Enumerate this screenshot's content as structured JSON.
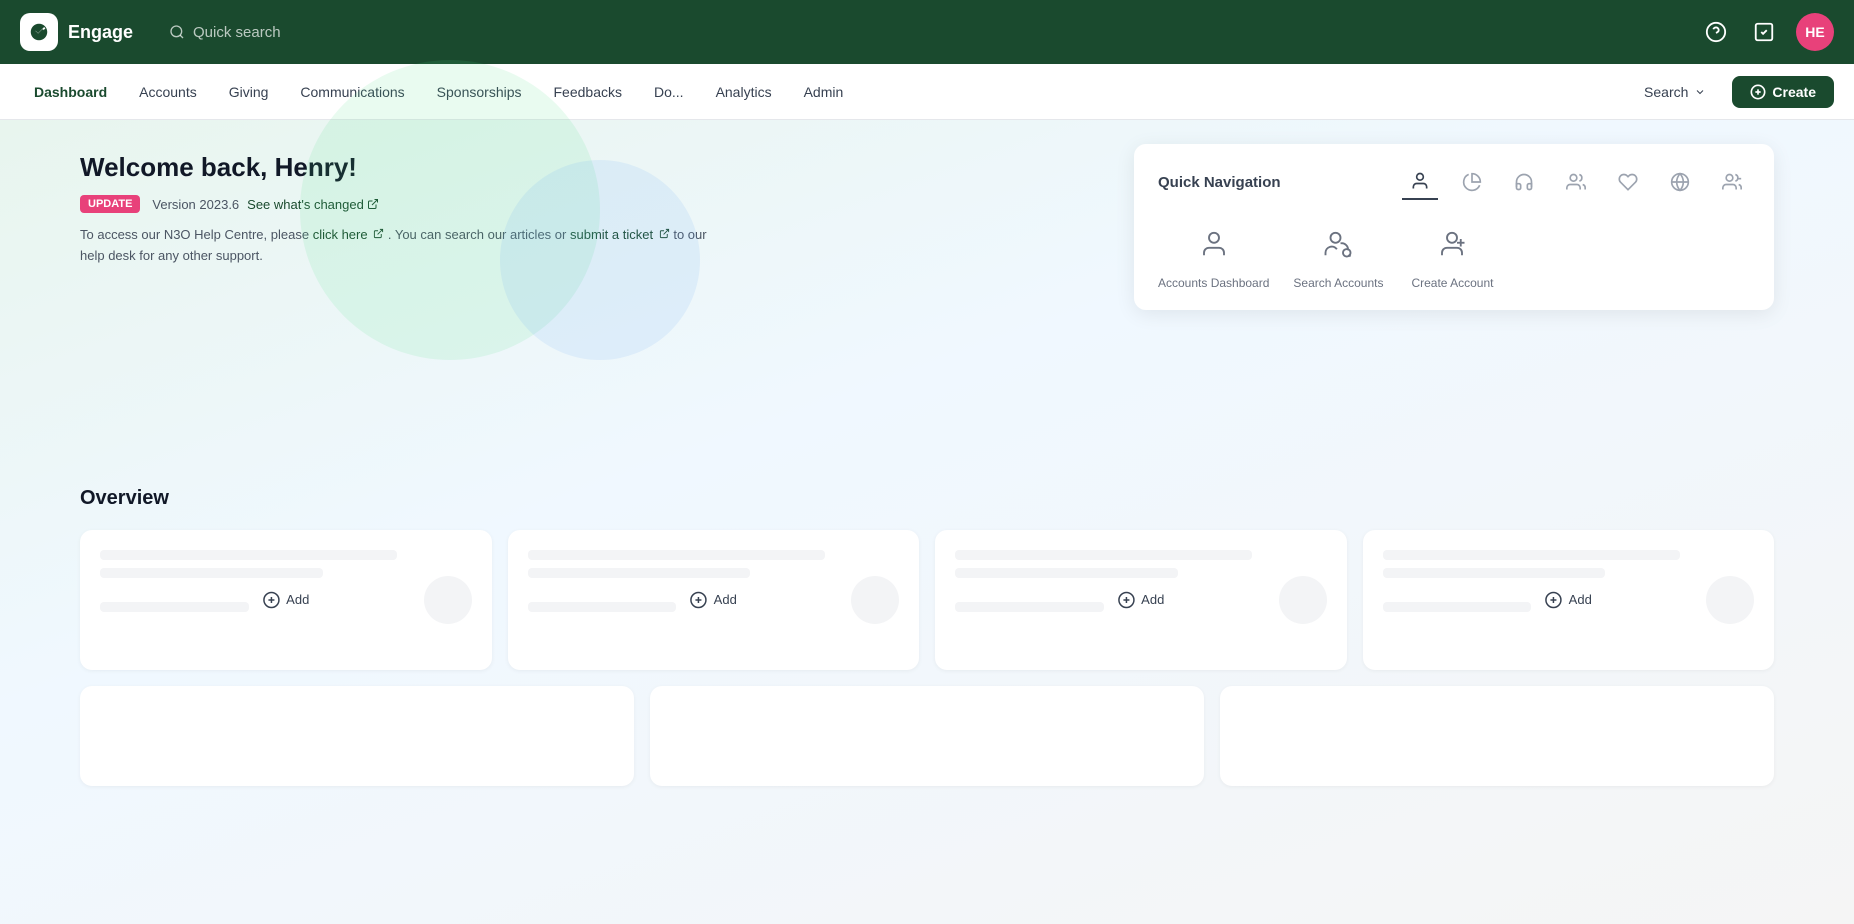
{
  "app": {
    "name": "Engage",
    "logo_alt": "engage-logo"
  },
  "topbar": {
    "quick_search_placeholder": "Quick search",
    "help_icon": "help-circle-icon",
    "task_icon": "task-icon",
    "avatar_initials": "HE",
    "avatar_color": "#e8417a"
  },
  "navbar": {
    "items": [
      {
        "label": "Dashboard",
        "active": true
      },
      {
        "label": "Accounts",
        "active": false
      },
      {
        "label": "Giving",
        "active": false
      },
      {
        "label": "Communications",
        "active": false
      },
      {
        "label": "Sponsorships",
        "active": false
      },
      {
        "label": "Feedbacks",
        "active": false
      },
      {
        "label": "Do...",
        "active": false
      },
      {
        "label": "Analytics",
        "active": false
      },
      {
        "label": "Admin",
        "active": false
      }
    ],
    "search_label": "Search",
    "create_label": "Create"
  },
  "welcome": {
    "title": "Welcome back, Henry!",
    "badge": "UPDATE",
    "version": "Version 2023.6",
    "see_changes": "See what's changed",
    "help_text_pre": "To access our N3O Help Centre, please",
    "click_here": "click here",
    "help_text_mid": ". You can search our articles or",
    "submit_ticket": "submit a ticket",
    "help_text_post": "to our help desk for any other support."
  },
  "quick_navigation": {
    "title": "Quick Navigation",
    "tabs": [
      {
        "name": "accounts",
        "icon": "person-icon",
        "active": true
      },
      {
        "name": "giving",
        "icon": "pie-chart-icon",
        "active": false
      },
      {
        "name": "communications",
        "icon": "headset-icon",
        "active": false
      },
      {
        "name": "sponsorships",
        "icon": "group-icon",
        "active": false
      },
      {
        "name": "favourites",
        "icon": "heart-icon",
        "active": false
      },
      {
        "name": "settings",
        "icon": "globe-icon",
        "active": false
      },
      {
        "name": "admin",
        "icon": "admin-group-icon",
        "active": false
      }
    ],
    "actions": [
      {
        "label": "Accounts Dashboard",
        "icon": "accounts-dashboard-icon"
      },
      {
        "label": "Search Accounts",
        "icon": "search-accounts-icon"
      },
      {
        "label": "Create Account",
        "icon": "create-account-icon"
      }
    ]
  },
  "overview": {
    "title": "Overview",
    "add_label": "Add",
    "cards_row1": [
      {
        "id": "card-1"
      },
      {
        "id": "card-2"
      },
      {
        "id": "card-3"
      },
      {
        "id": "card-4"
      }
    ],
    "cards_row2": [
      {
        "id": "card-5"
      },
      {
        "id": "card-6"
      },
      {
        "id": "card-7"
      }
    ]
  }
}
